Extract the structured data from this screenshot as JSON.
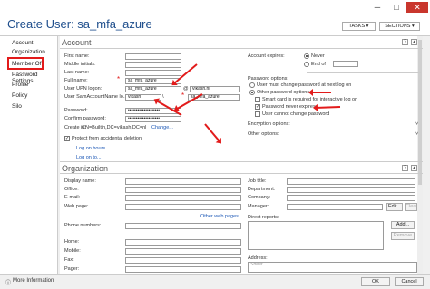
{
  "window": {
    "title": "Create User: sa_mfa_azure",
    "min": "─",
    "max": "□",
    "close": "✕"
  },
  "header": {
    "tasks": "TASKS ▾",
    "sections": "SECTIONS ▾"
  },
  "nav": {
    "items": [
      {
        "label": "Account"
      },
      {
        "label": "Organization"
      },
      {
        "label": "Member Of"
      },
      {
        "label": "Password Settings"
      },
      {
        "label": "Profile"
      },
      {
        "label": "Policy"
      },
      {
        "label": "Silo"
      }
    ]
  },
  "account": {
    "title": "Account",
    "first_name_label": "First name:",
    "middle_initials_label": "Middle initials:",
    "last_name_label": "Last name:",
    "full_name_label": "Full name:",
    "full_name_value": "sa_mfa_azure",
    "upn_label": "User UPN logon:",
    "upn_value": "sa_mfa_azure",
    "upn_domain": "vikash.nl",
    "sam_label": "User SamAccountName lo...",
    "sam_domain": "vikash",
    "sam_value": "sa_mfa_azure",
    "password_label": "Password:",
    "password_value": "••••••••••••••••••••",
    "confirm_label": "Confirm password:",
    "confirm_value": "••••••••••••••••••••",
    "create_in_label": "Create in:",
    "create_in_value": "CN=Builtin,DC=vikash,DC=nl",
    "change_link": "Change...",
    "protect_label": "Protect from accidental deletion",
    "protect_checked": true,
    "log_on_hours_link": "Log on hours...",
    "log_on_to_link": "Log on to...",
    "expires_label": "Account expires:",
    "never_label": "Never",
    "end_of_label": "End of",
    "password_options_label": "Password options:",
    "opt_must_change": "User must change password at next log on",
    "opt_other": "Other password options",
    "opt_smart_card": "Smart card is required for interactive log on",
    "opt_never_expires": "Password never expires",
    "opt_cannot_change": "User cannot change password",
    "encryption_label": "Encryption options:",
    "other_options_label": "Other options:"
  },
  "organization": {
    "title": "Organization",
    "display_name_label": "Display name:",
    "office_label": "Office:",
    "email_label": "E-mail:",
    "web_page_label": "Web page:",
    "other_web_link": "Other web pages...",
    "phone_label": "Phone numbers:",
    "home_label": "Home:",
    "mobile_label": "Mobile:",
    "fax_label": "Fax:",
    "pager_label": "Pager:",
    "job_title_label": "Job title:",
    "department_label": "Department:",
    "company_label": "Company:",
    "manager_label": "Manager:",
    "edit_button": "Edit...",
    "clear_button": "Clear",
    "direct_reports_label": "Direct reports:",
    "add_button": "Add...",
    "remove_button": "Remove",
    "address_label": "Address:",
    "street_placeholder": "Street"
  },
  "footer": {
    "more_info": "More Information",
    "ok": "OK",
    "cancel": "Cancel"
  },
  "colors": {
    "accent": "#1e4e8c",
    "annotation": "#e21b1b",
    "close": "#c9362d"
  }
}
